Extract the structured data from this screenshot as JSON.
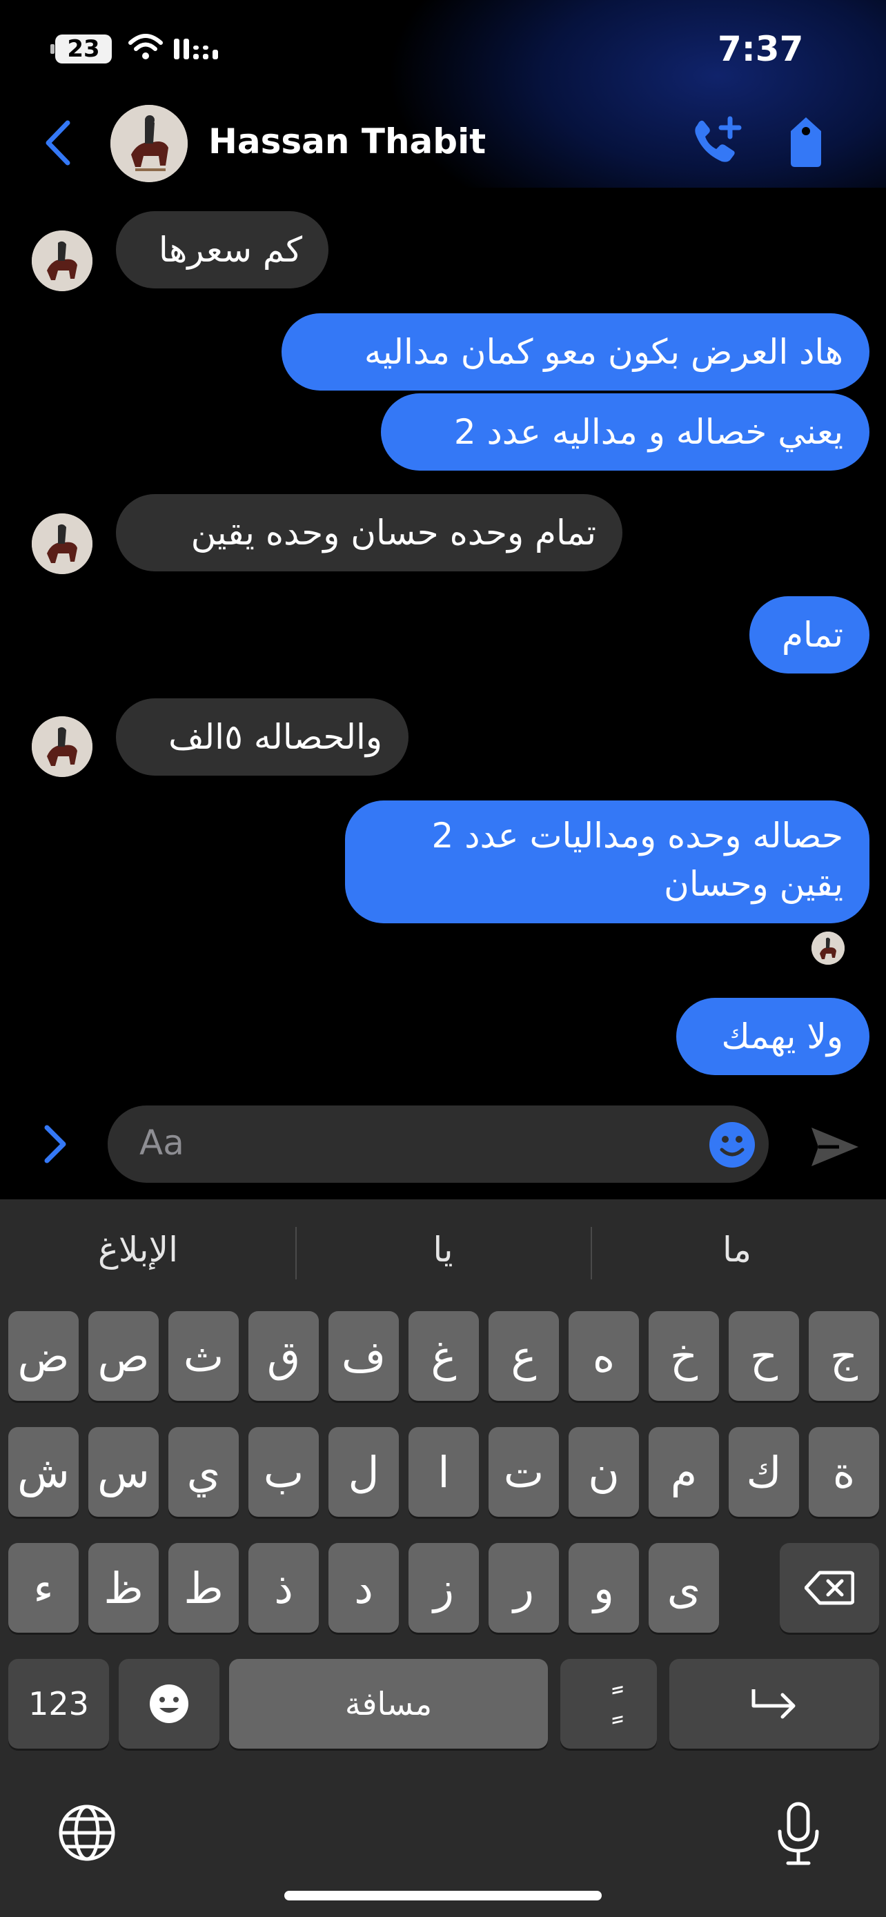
{
  "status_bar": {
    "time": "7:37",
    "battery": "23"
  },
  "header": {
    "contact_name": "Hassan Thabit"
  },
  "messages": [
    {
      "text": "كم سعرها"
    },
    {
      "text": "هاد العرض بكون معو كمان مداليه"
    },
    {
      "text": "يعني خصاله و مداليه عدد 2"
    },
    {
      "text": "تمام وحده حسان وحده يقين"
    },
    {
      "text": "تمام"
    },
    {
      "text": "والحصاله ٥الف"
    },
    {
      "text": "حصاله وحده ومداليات عدد 2 يقين وحسان"
    },
    {
      "text": "ولا يهمك"
    }
  ],
  "composer": {
    "placeholder": "Aa"
  },
  "keyboard": {
    "suggestions": [
      "الإبلاغ",
      "يا",
      "ما"
    ],
    "row1": [
      "ض",
      "ص",
      "ث",
      "ق",
      "ف",
      "غ",
      "ع",
      "ه",
      "خ",
      "ح",
      "ج"
    ],
    "row2": [
      "ش",
      "س",
      "ي",
      "ب",
      "ل",
      "ا",
      "ت",
      "ن",
      "م",
      "ك",
      "ة"
    ],
    "row3": [
      "ء",
      "ظ",
      "ط",
      "ذ",
      "د",
      "ز",
      "ر",
      "و",
      "ى"
    ],
    "numbers_key": "123",
    "space_key": "مسافة",
    "diacritic_key": "ًًٍ",
    "accent_color": "#3478f6"
  }
}
